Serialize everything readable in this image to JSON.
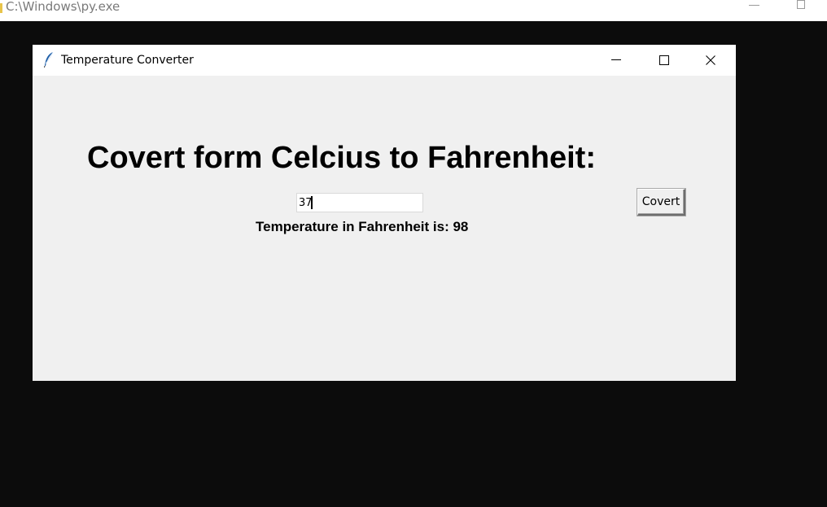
{
  "console": {
    "title": "C:\\Windows\\py.exe"
  },
  "window": {
    "title": "Temperature Converter",
    "icon": "tk-feather-icon"
  },
  "main": {
    "heading": "Covert form Celcius to Fahrenheit:",
    "input_value": "37",
    "convert_label": "Covert",
    "result_text": "Temperature in Fahrenheit is: 98"
  },
  "colors": {
    "window_bg": "#f0f0f0",
    "titlebar_bg": "#ffffff",
    "desktop_bg": "#0c0c0c"
  }
}
